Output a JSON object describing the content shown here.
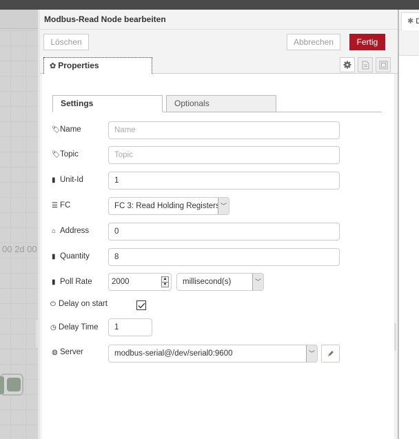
{
  "workspace": {
    "partial_text": "00 2d 00"
  },
  "tray": {
    "title": "Modbus-Read Node bearbeiten",
    "buttons": {
      "delete": "Löschen",
      "cancel": "Abbrechen",
      "done": "Fertig"
    },
    "colors": {
      "done_button": "#ad1625"
    },
    "properties_tab": {
      "label": "Properties",
      "icon": "gear-icon"
    },
    "toolbar_icons": [
      "gear-icon",
      "document-icon",
      "frame-icon"
    ],
    "inner_tabs": [
      {
        "label": "Settings",
        "active": true
      },
      {
        "label": "Optionals",
        "active": false
      }
    ],
    "form": {
      "name": {
        "label": "Name",
        "icon": "tag-icon",
        "value": "",
        "placeholder": "Name"
      },
      "topic": {
        "label": "Topic",
        "icon": "tag-icon",
        "value": "",
        "placeholder": "Topic"
      },
      "unit_id": {
        "label": "Unit-Id",
        "icon": "bookmark-icon",
        "value": "1"
      },
      "fc": {
        "label": "FC",
        "icon": "list-icon",
        "selected": "FC 3: Read Holding Registers"
      },
      "address": {
        "label": "Address",
        "icon": "home-icon",
        "value": "0"
      },
      "quantity": {
        "label": "Quantity",
        "icon": "bookmark-icon",
        "value": "8"
      },
      "poll_rate": {
        "label": "Poll Rate",
        "icon": "bookmark-icon",
        "value": "2000",
        "unit": "millisecond(s)"
      },
      "delay_on_start": {
        "label": "Delay on start",
        "icon": "power-icon",
        "checked": true
      },
      "delay_time": {
        "label": "Delay Time",
        "icon": "clock-icon",
        "value": "1"
      },
      "server": {
        "label": "Server",
        "icon": "globe-icon",
        "selected": "modbus-serial@/dev/serial0:9600"
      }
    }
  },
  "sidebar": {
    "tab_label": "D",
    "tab_icon": "bug-icon"
  }
}
